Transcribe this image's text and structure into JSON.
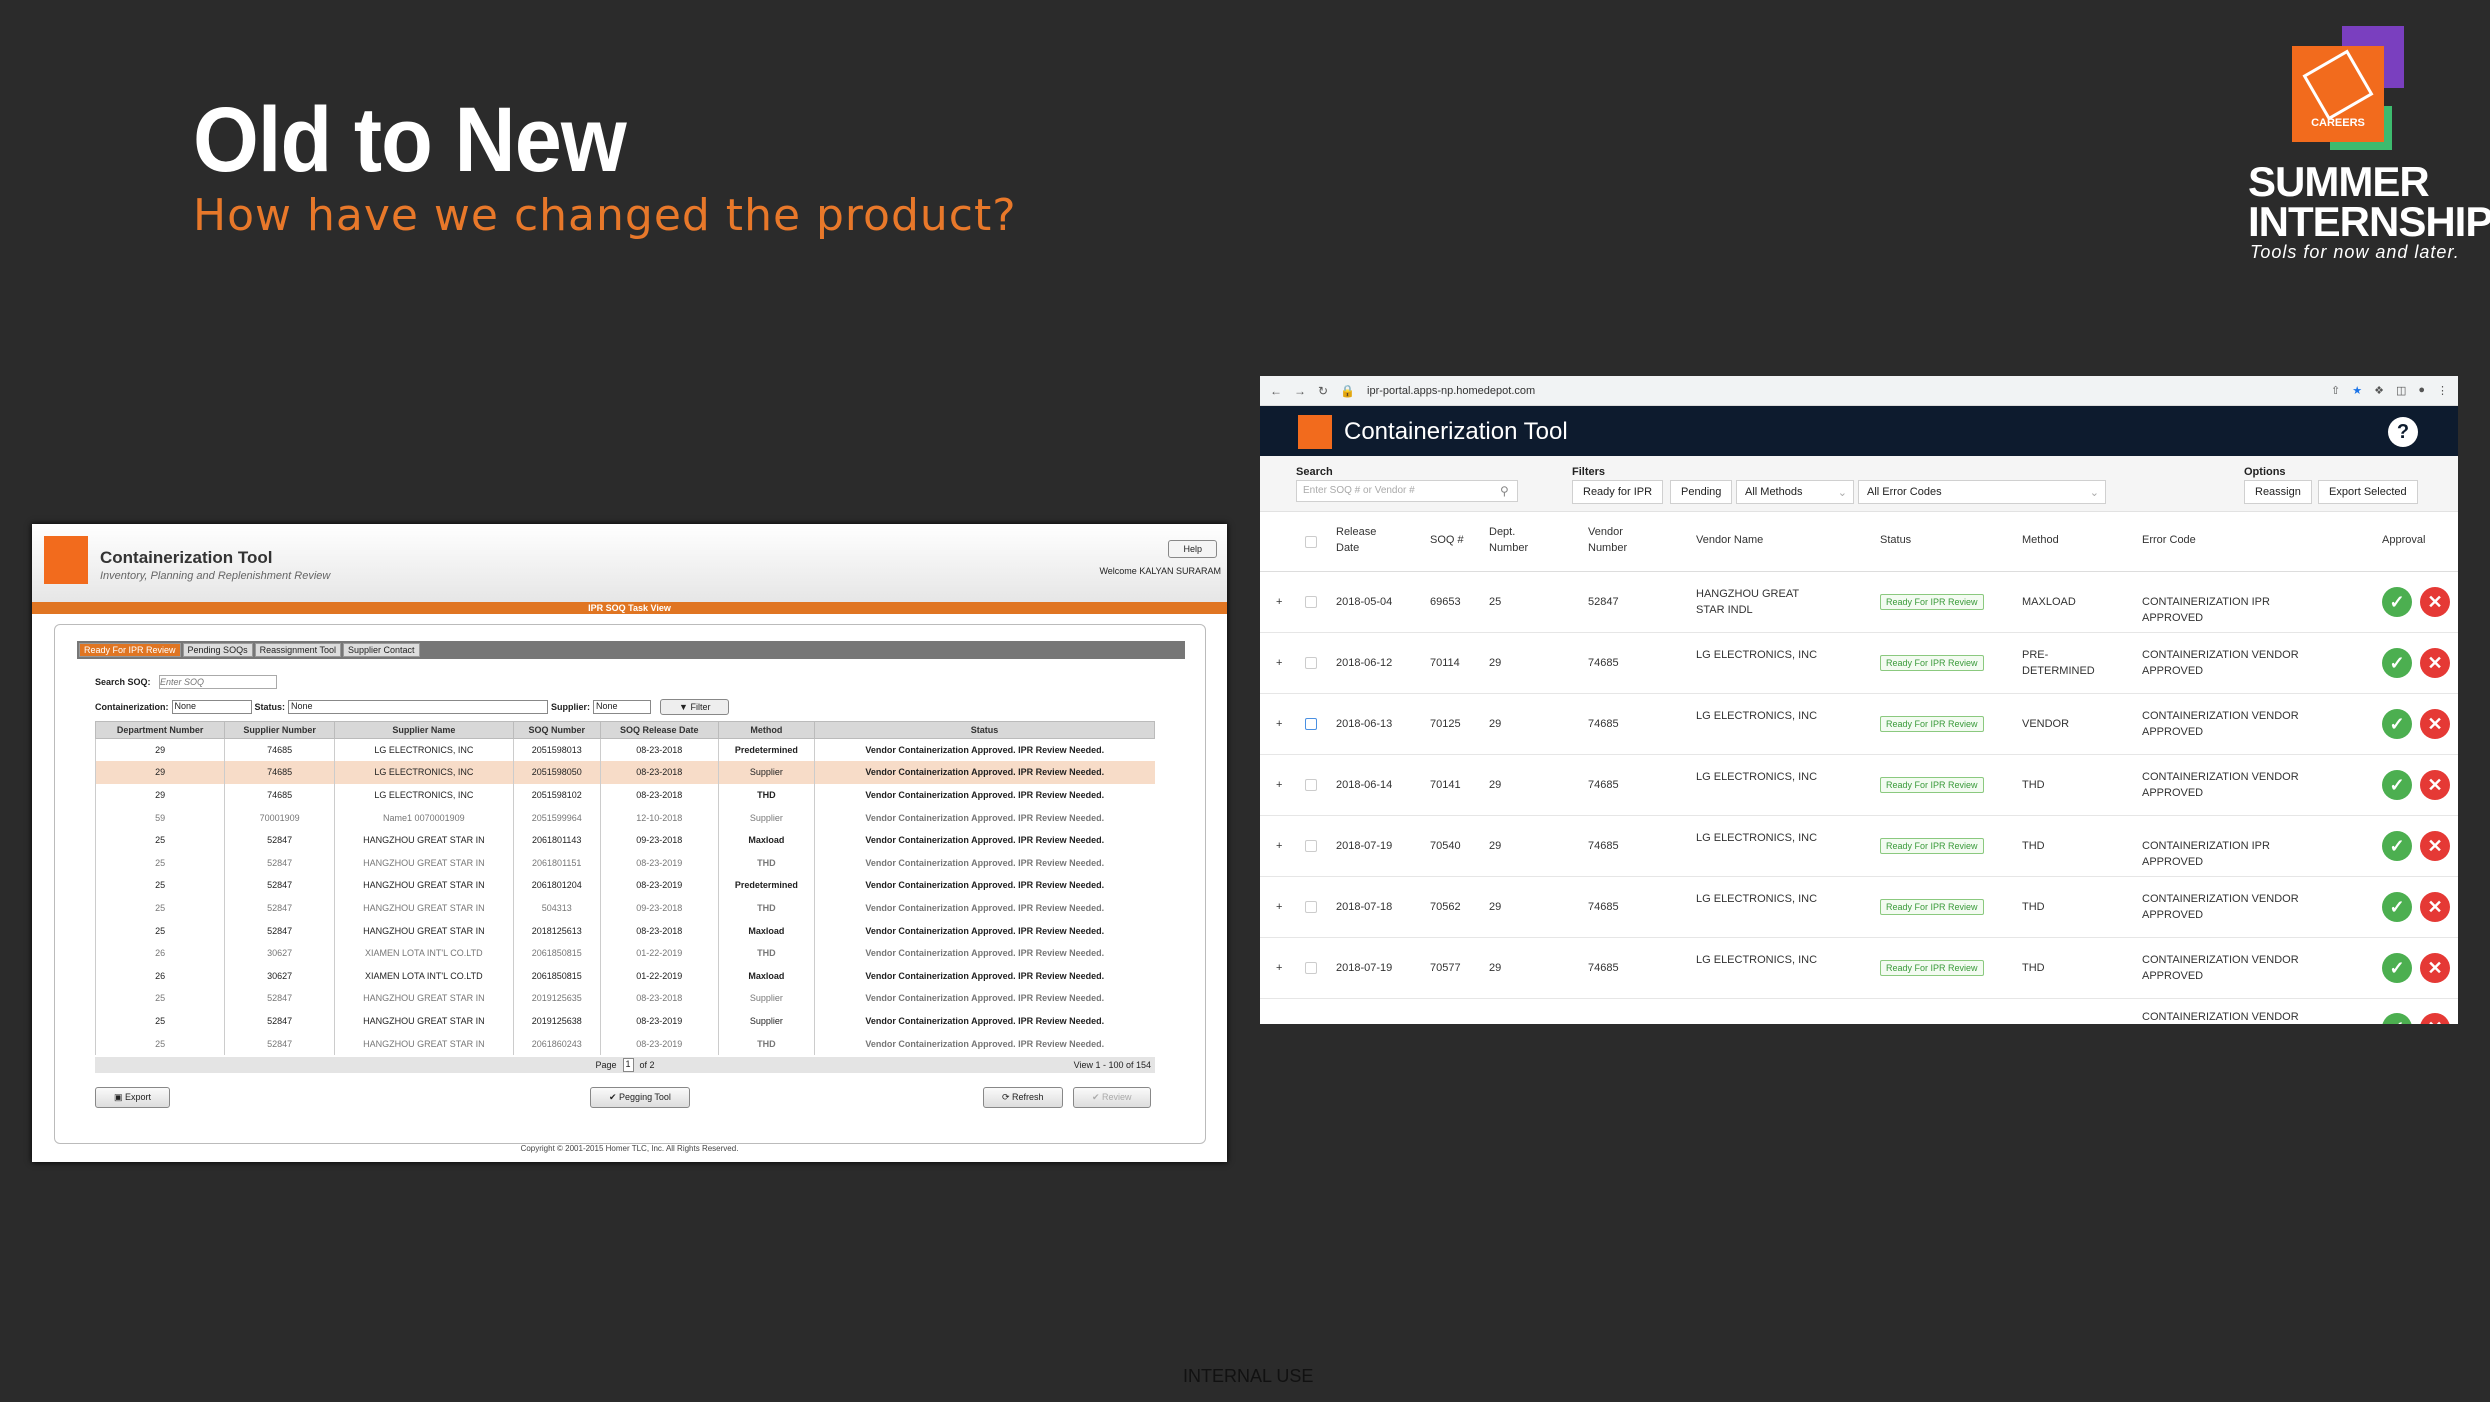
{
  "slide": {
    "title": "Old to New",
    "subtitle": "How have we changed the product?",
    "brand_lines": [
      "SUMMER",
      "INTERNSHIP"
    ],
    "brand_tagline": "Tools for now and later.",
    "brand_logo_text": "CAREERS",
    "footer": "INTERNAL USE"
  },
  "old_app": {
    "title": "Containerization Tool",
    "subtitle": "Inventory, Planning and Replenishment Review",
    "help_label": "Help",
    "welcome": "Welcome KALYAN SURARAM",
    "band": "IPR SOQ Task View",
    "tabs": [
      "Ready For IPR Review",
      "Pending SOQs",
      "Reassignment Tool",
      "Supplier Contact"
    ],
    "search_label": "Search SOQ:",
    "search_placeholder": "Enter SOQ",
    "containerization_label": "Containerization:",
    "containerization_value": "None",
    "status_label": "Status:",
    "status_value": "None",
    "supplier_label": "Supplier:",
    "supplier_value": "None",
    "filter_label": "Filter",
    "columns": [
      "Department Number",
      "Supplier Number",
      "Supplier Name",
      "SOQ Number",
      "SOQ Release Date",
      "Method",
      "Status"
    ],
    "rows": [
      [
        "29",
        "74685",
        "LG ELECTRONICS, INC",
        "2051598013",
        "08-23-2018",
        "Predetermined",
        "Vendor Containerization Approved. IPR Review Needed."
      ],
      [
        "29",
        "74685",
        "LG ELECTRONICS, INC",
        "2051598050",
        "08-23-2018",
        "Supplier",
        "Vendor Containerization Approved. IPR Review Needed."
      ],
      [
        "29",
        "74685",
        "LG ELECTRONICS, INC",
        "2051598102",
        "08-23-2018",
        "THD",
        "Vendor Containerization Approved. IPR Review Needed."
      ],
      [
        "59",
        "70001909",
        "Name1 0070001909",
        "2051599964",
        "12-10-2018",
        "Supplier",
        "Vendor Containerization Approved. IPR Review Needed."
      ],
      [
        "25",
        "52847",
        "HANGZHOU GREAT STAR IN",
        "2061801143",
        "09-23-2018",
        "Maxload",
        "Vendor Containerization Approved. IPR Review Needed."
      ],
      [
        "25",
        "52847",
        "HANGZHOU GREAT STAR IN",
        "2061801151",
        "08-23-2019",
        "THD",
        "Vendor Containerization Approved. IPR Review Needed."
      ],
      [
        "25",
        "52847",
        "HANGZHOU GREAT STAR IN",
        "2061801204",
        "08-23-2019",
        "Predetermined",
        "Vendor Containerization Approved. IPR Review Needed."
      ],
      [
        "25",
        "52847",
        "HANGZHOU GREAT STAR IN",
        "504313",
        "09-23-2018",
        "THD",
        "Vendor Containerization Approved. IPR Review Needed."
      ],
      [
        "25",
        "52847",
        "HANGZHOU GREAT STAR IN",
        "2018125613",
        "08-23-2018",
        "Maxload",
        "Vendor Containerization Approved. IPR Review Needed."
      ],
      [
        "26",
        "30627",
        "XIAMEN LOTA INT'L CO.LTD",
        "2061850815",
        "01-22-2019",
        "THD",
        "Vendor Containerization Approved. IPR Review Needed."
      ],
      [
        "26",
        "30627",
        "XIAMEN LOTA INT'L CO.LTD",
        "2061850815",
        "01-22-2019",
        "Maxload",
        "Vendor Containerization Approved. IPR Review Needed."
      ],
      [
        "25",
        "52847",
        "HANGZHOU GREAT STAR IN",
        "2019125635",
        "08-23-2018",
        "Supplier",
        "Vendor Containerization Approved. IPR Review Needed."
      ],
      [
        "25",
        "52847",
        "HANGZHOU GREAT STAR IN",
        "2019125638",
        "08-23-2019",
        "Supplier",
        "Vendor Containerization Approved. IPR Review Needed."
      ],
      [
        "25",
        "52847",
        "HANGZHOU GREAT STAR IN",
        "2061860243",
        "08-23-2019",
        "THD",
        "Vendor Containerization Approved. IPR Review Needed."
      ]
    ],
    "pager_page": "Page",
    "pager_num": "1",
    "pager_of": "of 2",
    "pager_view": "View 1 - 100 of 154",
    "export_label": "Export",
    "pegging_label": "Pegging Tool",
    "refresh_label": "Refresh",
    "review_label": "Review",
    "copyright": "Copyright © 2001-2015 Homer TLC, Inc. All Rights Reserved."
  },
  "new_app": {
    "url": "ipr-portal.apps-np.homedepot.com",
    "title": "Containerization Tool",
    "help_label": "?",
    "search_label": "Search",
    "search_placeholder": "Enter SOQ # or Vendor #",
    "filters_label": "Filters",
    "filter_ready": "Ready for IPR",
    "filter_pending": "Pending",
    "filter_methods": "All Methods",
    "filter_errors": "All Error Codes",
    "options_label": "Options",
    "reassign_label": "Reassign",
    "export_label": "Export Selected",
    "columns": {
      "release": "Release Date",
      "soq": "SOQ #",
      "dept": "Dept. Number",
      "vendor_num": "Vendor Number",
      "vendor_name": "Vendor Name",
      "status": "Status",
      "method": "Method",
      "error": "Error Code",
      "approval": "Approval"
    },
    "rows": [
      {
        "date": "2018-05-04",
        "soq": "69653",
        "dept": "25",
        "vnum": "52847",
        "vname": "HANGZHOU GREAT STAR INDL",
        "status": "Ready For IPR Review",
        "method": "MAXLOAD",
        "error": "CONTAINERIZATION IPR APPROVED"
      },
      {
        "date": "2018-06-12",
        "soq": "70114",
        "dept": "29",
        "vnum": "74685",
        "vname": "LG ELECTRONICS, INC",
        "status": "Ready For IPR Review",
        "method": "PRE-DETERMINED",
        "error": "CONTAINERIZATION VENDOR APPROVED"
      },
      {
        "date": "2018-06-13",
        "soq": "70125",
        "dept": "29",
        "vnum": "74685",
        "vname": "LG ELECTRONICS, INC",
        "status": "Ready For IPR Review",
        "method": "VENDOR",
        "error": "CONTAINERIZATION VENDOR APPROVED"
      },
      {
        "date": "2018-06-14",
        "soq": "70141",
        "dept": "29",
        "vnum": "74685",
        "vname": "LG ELECTRONICS, INC",
        "status": "Ready For IPR Review",
        "method": "THD",
        "error": "CONTAINERIZATION VENDOR APPROVED"
      },
      {
        "date": "2018-07-19",
        "soq": "70540",
        "dept": "29",
        "vnum": "74685",
        "vname": "LG ELECTRONICS, INC",
        "status": "Ready For IPR Review",
        "method": "THD",
        "error": "CONTAINERIZATION IPR APPROVED"
      },
      {
        "date": "2018-07-18",
        "soq": "70562",
        "dept": "29",
        "vnum": "74685",
        "vname": "LG ELECTRONICS, INC",
        "status": "Ready For IPR Review",
        "method": "THD",
        "error": "CONTAINERIZATION VENDOR APPROVED"
      },
      {
        "date": "2018-07-19",
        "soq": "70577",
        "dept": "29",
        "vnum": "74685",
        "vname": "LG ELECTRONICS, INC",
        "status": "Ready For IPR Review",
        "method": "THD",
        "error": "CONTAINERIZATION VENDOR APPROVED"
      }
    ],
    "partial_error": "CONTAINERIZATION VENDOR"
  },
  "colors": {
    "accent": "#e8782a",
    "brand_orange": "#f26b1d",
    "navy": "#0d1b2e",
    "approve": "#4caf50",
    "reject": "#e53935"
  },
  "icons": [
    "filter-icon",
    "export-icon",
    "pegging-icon",
    "refresh-icon",
    "check-icon",
    "close-icon",
    "lock-icon",
    "star-icon",
    "back-icon",
    "forward-icon",
    "reload-icon",
    "search-icon",
    "chevron-down-icon",
    "help-icon"
  ]
}
